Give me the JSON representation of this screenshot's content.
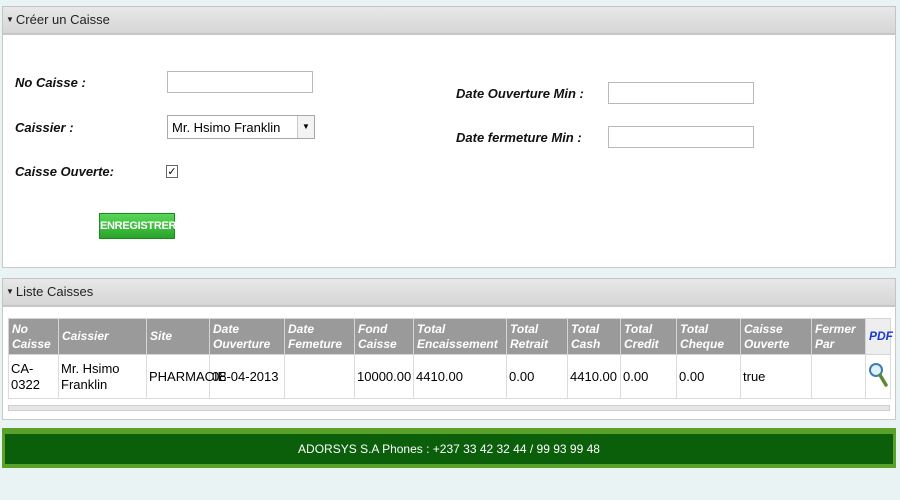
{
  "create_panel": {
    "title": "Créer un Caisse",
    "no_caisse_label": "No Caisse :",
    "no_caisse_value": "",
    "caissier_label": "Caissier :",
    "caissier_selected": "Mr. Hsimo Franklin",
    "caisse_ouverte_label": "Caisse Ouverte:",
    "caisse_ouverte_checked": "✓",
    "date_ouverture_min_label": "Date Ouverture Min :",
    "date_ouverture_min_value": "",
    "date_fermeture_min_label": "Date fermeture Min :",
    "date_fermeture_min_value": "",
    "save_label": "ENREGISTRER"
  },
  "list_panel": {
    "title": "Liste Caisses",
    "columns": [
      "No Caisse",
      "Caissier",
      "Site",
      "Date Ouverture",
      "Date Femeture",
      "Fond Caisse",
      "Total Encaissement",
      "Total Retrait",
      "Total Cash",
      "Total Credit",
      "Total Cheque",
      "Caisse Ouverte",
      "Fermer Par",
      "PDF"
    ],
    "rows": [
      {
        "no_caisse": "CA-0322",
        "caissier": "Mr. Hsimo Franklin",
        "site": "PHARMACIE",
        "date_ouverture": "08-04-2013",
        "date_fermeture": "",
        "fond_caisse": "10000.00",
        "total_encaissement": "4410.00",
        "total_retrait": "0.00",
        "total_cash": "4410.00",
        "total_credit": "0.00",
        "total_cheque": "0.00",
        "caisse_ouverte": "true",
        "fermer_par": "",
        "action_icon": "magnifier-icon"
      }
    ]
  },
  "footer": {
    "text": "ADORSYS S.A Phones : +237 33 42 32 44 / 99 93 99 48"
  },
  "colors": {
    "footer_outer": "#5aa12a",
    "footer_inner": "#0b5f0b",
    "button_green": "#2aa52a",
    "table_header": "#9a9a9a",
    "pdf_link": "#1a3bd1"
  }
}
